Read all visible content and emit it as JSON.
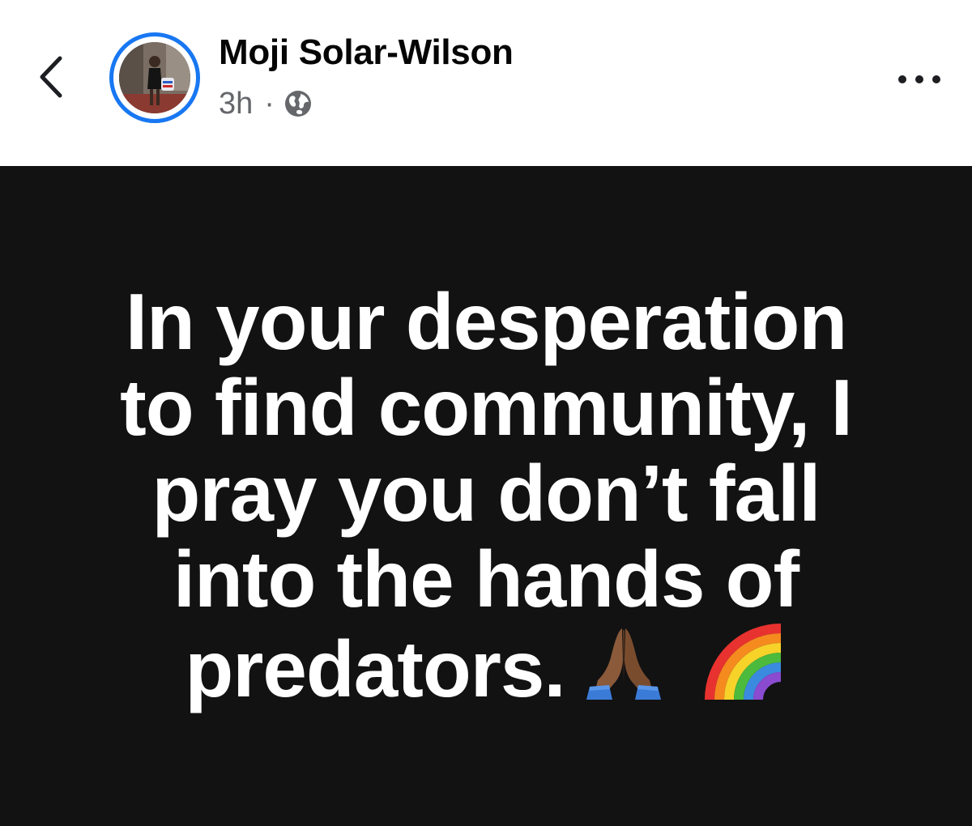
{
  "header": {
    "back_icon": "chevron-left-icon",
    "author_name": "Moji Solar-Wilson",
    "timestamp": "3h",
    "separator": "·",
    "privacy_icon": "globe-icon",
    "more_icon": "more-horizontal-icon",
    "avatar_ring_color": "#1877f2"
  },
  "post": {
    "background_color": "#121212",
    "text_color": "#ffffff",
    "lines": [
      "In your desperation",
      "to find community, I",
      "pray you don’t fall",
      "into the hands of",
      "predators."
    ],
    "emojis": [
      "folded-hands-medium-dark-skin-emoji",
      "rainbow-emoji"
    ]
  }
}
